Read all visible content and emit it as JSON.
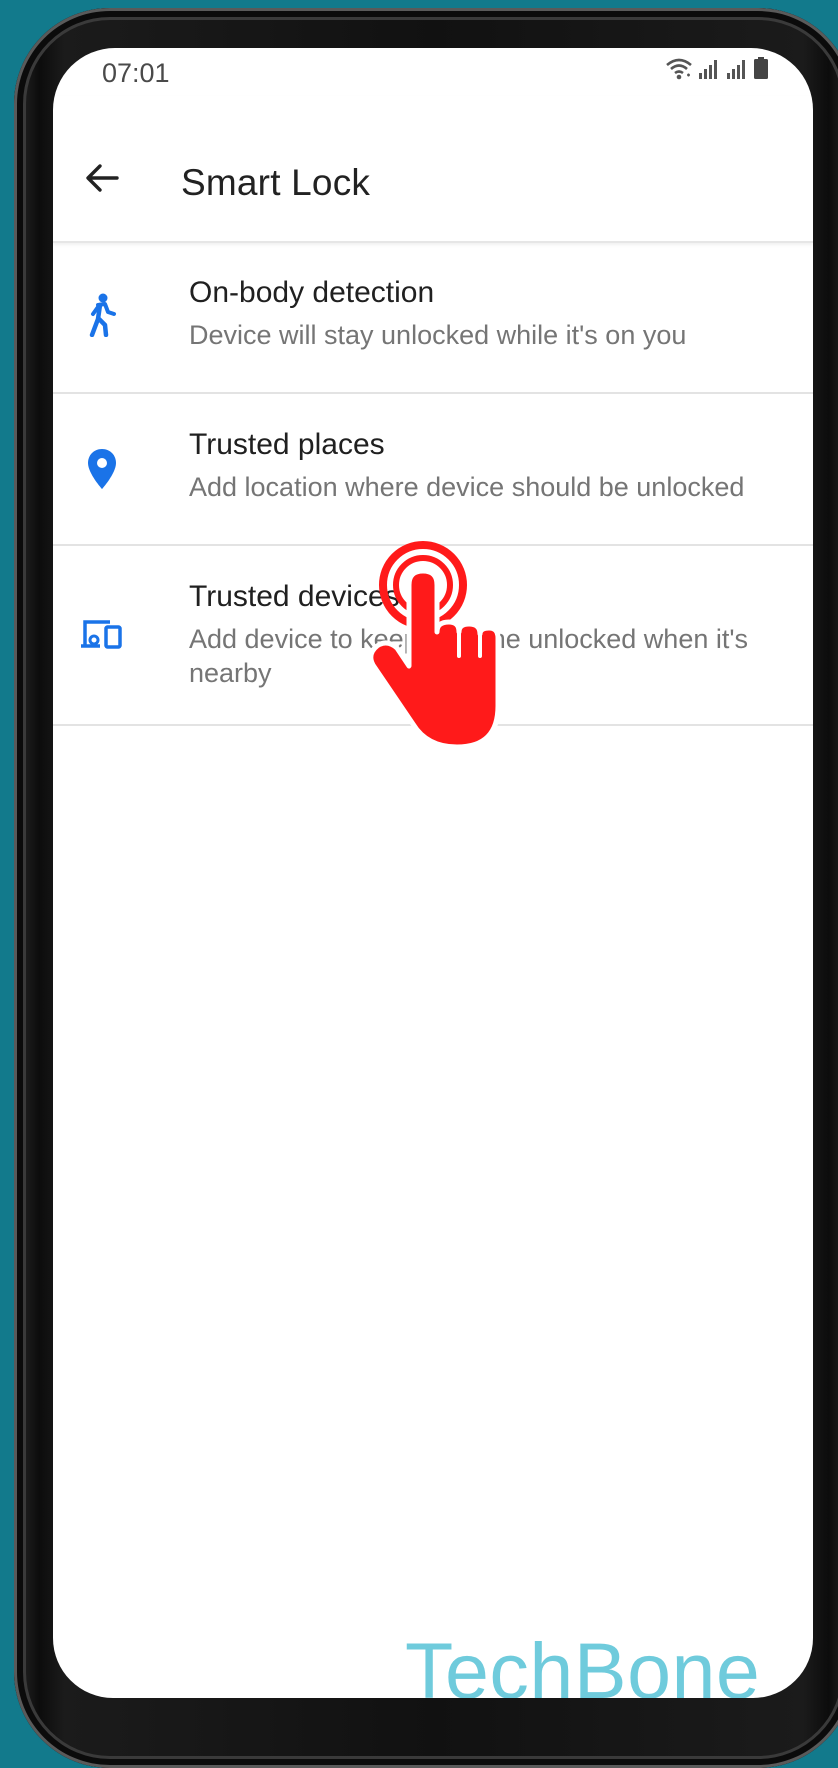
{
  "status_bar": {
    "time": "07:01",
    "icons": [
      "wifi-icon",
      "signal-icon",
      "signal-icon",
      "battery-icon"
    ]
  },
  "app_bar": {
    "back_icon": "arrow-back-icon",
    "title": "Smart Lock"
  },
  "items": [
    {
      "icon": "walking-person-icon",
      "title": "On-body detection",
      "subtitle": "Device will stay unlocked while it's on you"
    },
    {
      "icon": "location-pin-icon",
      "title": "Trusted places",
      "subtitle": "Add location where device should be unlocked"
    },
    {
      "icon": "devices-icon",
      "title": "Trusted devices",
      "subtitle": "Add device to keep this one unlocked when it's nearby"
    }
  ],
  "overlay": {
    "icon": "tap-hand-icon",
    "color": "#ff1a1a"
  },
  "watermark": "TechBone",
  "colors": {
    "accent": "#1a73e8",
    "background": "#127a8c",
    "watermark": "#56c2d6"
  }
}
